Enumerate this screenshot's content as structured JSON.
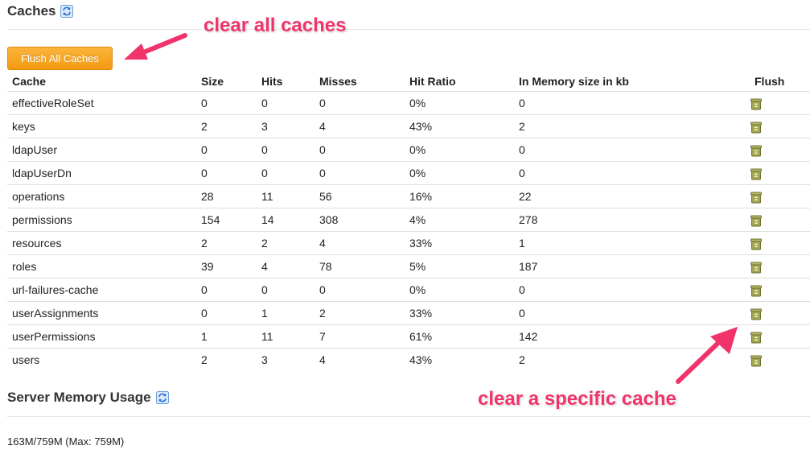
{
  "caches_section": {
    "title": "Caches",
    "refresh_icon": "refresh-icon"
  },
  "flush_all_label": "Flush All Caches",
  "table": {
    "headers": [
      "Cache",
      "Size",
      "Hits",
      "Misses",
      "Hit Ratio",
      "In Memory size in kb",
      "Flush"
    ],
    "rows": [
      {
        "name": "effectiveRoleSet",
        "size": "0",
        "hits": "0",
        "misses": "0",
        "ratio": "0%",
        "mem": "0"
      },
      {
        "name": "keys",
        "size": "2",
        "hits": "3",
        "misses": "4",
        "ratio": "43%",
        "mem": "2"
      },
      {
        "name": "ldapUser",
        "size": "0",
        "hits": "0",
        "misses": "0",
        "ratio": "0%",
        "mem": "0"
      },
      {
        "name": "ldapUserDn",
        "size": "0",
        "hits": "0",
        "misses": "0",
        "ratio": "0%",
        "mem": "0"
      },
      {
        "name": "operations",
        "size": "28",
        "hits": "11",
        "misses": "56",
        "ratio": "16%",
        "mem": "22"
      },
      {
        "name": "permissions",
        "size": "154",
        "hits": "14",
        "misses": "308",
        "ratio": "4%",
        "mem": "278"
      },
      {
        "name": "resources",
        "size": "2",
        "hits": "2",
        "misses": "4",
        "ratio": "33%",
        "mem": "1"
      },
      {
        "name": "roles",
        "size": "39",
        "hits": "4",
        "misses": "78",
        "ratio": "5%",
        "mem": "187"
      },
      {
        "name": "url-failures-cache",
        "size": "0",
        "hits": "0",
        "misses": "0",
        "ratio": "0%",
        "mem": "0"
      },
      {
        "name": "userAssignments",
        "size": "0",
        "hits": "1",
        "misses": "2",
        "ratio": "33%",
        "mem": "0"
      },
      {
        "name": "userPermissions",
        "size": "1",
        "hits": "11",
        "misses": "7",
        "ratio": "61%",
        "mem": "142"
      },
      {
        "name": "users",
        "size": "2",
        "hits": "3",
        "misses": "4",
        "ratio": "43%",
        "mem": "2"
      }
    ]
  },
  "memory_section": {
    "title": "Server Memory Usage",
    "value": "163M/759M (Max: 759M)"
  },
  "annotations": {
    "clear_all": "clear all caches",
    "clear_specific": "clear a specific cache"
  },
  "colors": {
    "accent_orange": "#f7a21b",
    "annotation_pink": "#f0346b",
    "trash_olive": "#8a8d3c"
  },
  "icons": {
    "flush_row": "trash-icon",
    "refresh": "refresh-icon"
  }
}
